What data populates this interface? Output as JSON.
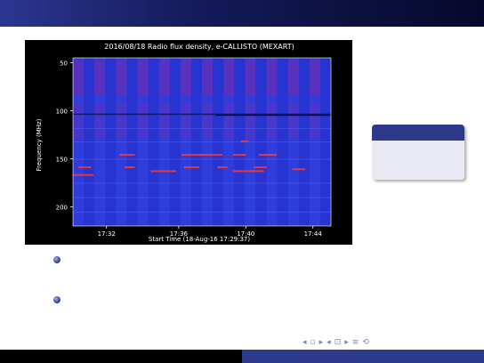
{
  "chart_data": {
    "type": "heatmap",
    "title": "2016/08/18  Radio flux density, e-CALLISTO (MEXART)",
    "xlabel": "Start Time (18-Aug-16 17:29:37)",
    "ylabel": "Frequency (MHz)",
    "x_ticks": [
      "17:32",
      "17:36",
      "17:40",
      "17:44"
    ],
    "y_ticks": [
      "50",
      "100",
      "150",
      "200"
    ],
    "ylim": [
      45,
      220
    ],
    "colors": {
      "background": "#2a38d8",
      "hot": "#ff3a2a",
      "band": "#7a2aa8"
    }
  },
  "nav_icons": [
    "frame-prev-icon",
    "frame-next-icon",
    "subsection-prev-icon",
    "subsection-next-icon",
    "section-prev-icon",
    "section-next-icon",
    "align-icon",
    "search-icon"
  ]
}
